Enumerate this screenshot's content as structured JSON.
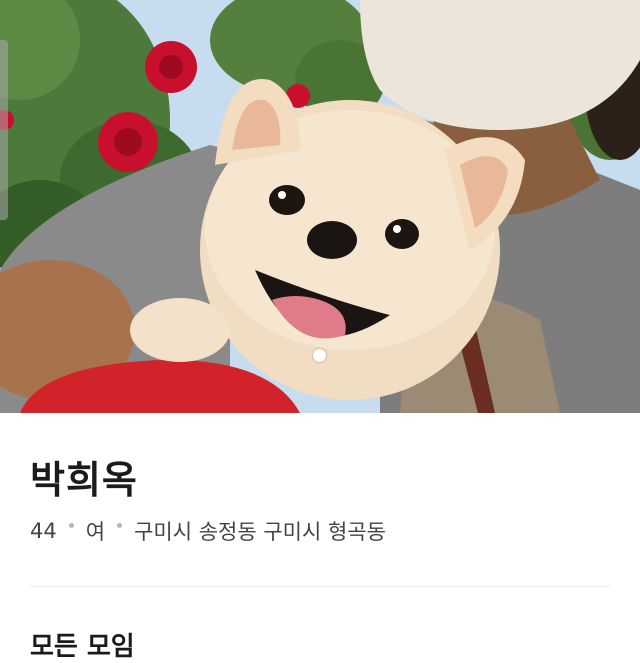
{
  "profile": {
    "name": "박희옥",
    "age": "44",
    "gender": "여",
    "locations": "구미시 송정동 구미시 형곡동"
  },
  "section": {
    "heading": "모든 모임"
  },
  "photo": {
    "subject": "dog-with-person-photo",
    "page_indicator": {
      "current": 1
    }
  }
}
